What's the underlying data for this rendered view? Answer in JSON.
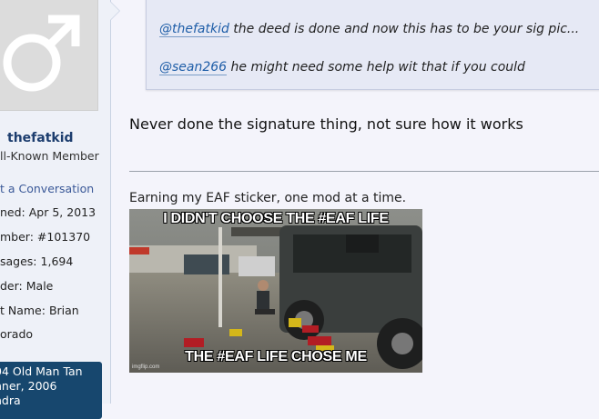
{
  "sidebar": {
    "username": "thefatkid",
    "user_title": "ll-Known Member",
    "start_conversation": "t a Conversation",
    "info": [
      {
        "label": "ned:",
        "value": "Apr 5, 2013"
      },
      {
        "label": "mber:",
        "value": "#101370"
      },
      {
        "label": "sages:",
        "value": "1,694"
      },
      {
        "label": "der:",
        "value": "Male"
      },
      {
        "label": "t Name:",
        "value": "Brian"
      },
      {
        "label": "orado",
        "value": ""
      }
    ],
    "vehicle": [
      "04 Old Man Tan",
      "nner, 2006",
      "ndra"
    ]
  },
  "quote": {
    "line1_mention": "@thefatkid",
    "line1_text": " the deed is done and now this has to be your sig pic...",
    "line2_mention": "@sean266",
    "line2_text": " he might need some help wit that if you could"
  },
  "post": {
    "reply": "Never done the signature thing, not sure how it works",
    "signature": "Earning my EAF sticker, one mod at a time."
  },
  "meme": {
    "top_text": "I DIDN'T CHOOSE THE #EAF LIFE",
    "bottom_text": "THE #EAF LIFE CHOSE ME",
    "watermark": "imgflip.com"
  },
  "colors": {
    "link": "#1f5ea8",
    "vehicle_bg": "#17476e",
    "username": "#1c3d6e"
  }
}
